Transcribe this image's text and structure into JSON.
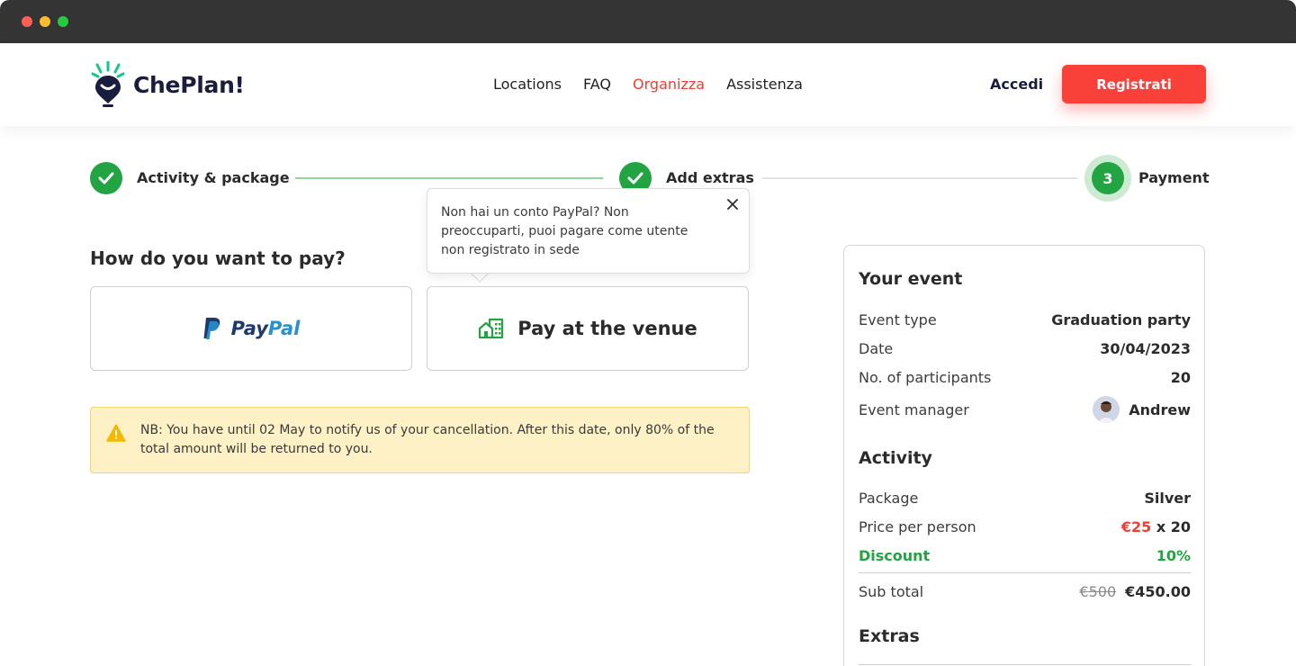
{
  "brand": {
    "name": "ChePlan!",
    "accent": "#f94039",
    "green": "#21a441"
  },
  "nav": {
    "items": [
      "Locations",
      "FAQ",
      "Organizza",
      "Assistenza"
    ],
    "active": "Organizza"
  },
  "auth": {
    "login_label": "Accedi",
    "signup_label": "Registrati"
  },
  "stepper": {
    "steps": [
      {
        "label": "Activity & package",
        "state": "done"
      },
      {
        "label": "Add extras",
        "state": "done"
      },
      {
        "label": "Payment",
        "number": "3",
        "state": "current"
      }
    ]
  },
  "tooltip": {
    "text": "Non hai un conto PayPal? Non preoccuparti, puoi pagare come utente non registrato in sede"
  },
  "payment": {
    "question": "How do you want to pay?",
    "paypal": {
      "part1": "Pay",
      "part2": "Pal"
    },
    "venue_label": "Pay at the venue"
  },
  "notice": {
    "text": "NB: You have until 02 May to notify us of your cancellation. After this date, only 80% of the total amount will be returned to you."
  },
  "summary": {
    "event_title": "Your event",
    "event": {
      "type_label": "Event type",
      "type_value": "Graduation party",
      "date_label": "Date",
      "date_value": "30/04/2023",
      "participants_label": "No. of participants",
      "participants_value": "20",
      "manager_label": "Event manager",
      "manager_value": "Andrew"
    },
    "activity_title": "Activity",
    "activity": {
      "package_label": "Package",
      "package_value": "Silver",
      "price_label": "Price per person",
      "price_value": "€25",
      "price_mult": "x 20",
      "discount_label": "Discount",
      "discount_value": "10%",
      "subtotal_label": "Sub total",
      "subtotal_old": "€500",
      "subtotal_value": "€450.00"
    },
    "extras_title": "Extras"
  }
}
